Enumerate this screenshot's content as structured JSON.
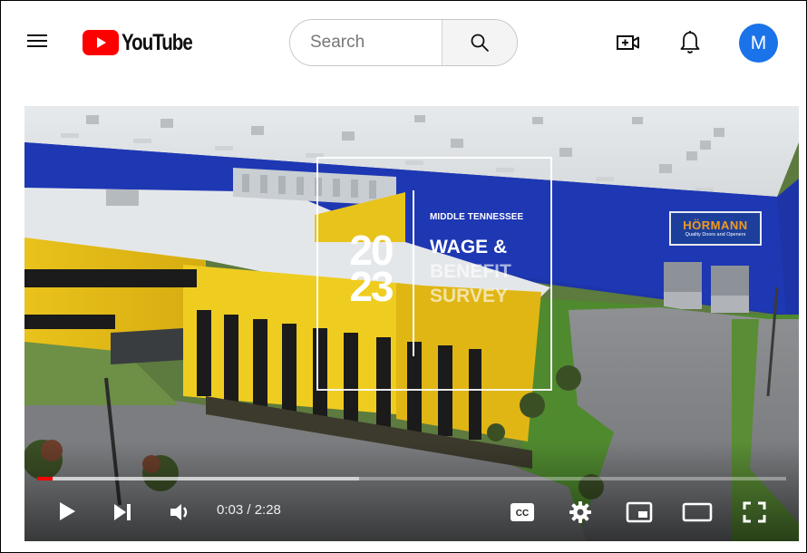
{
  "header": {
    "logo_text": "YouTube",
    "search_placeholder": "Search",
    "avatar_letter": "M",
    "brand_red": "#ff0000",
    "avatar_color": "#1a73e8"
  },
  "icons": {
    "menu": "hamburger-menu-icon",
    "search": "search-icon",
    "create": "create-video-icon",
    "notifications": "bell-icon"
  },
  "video": {
    "overlay": {
      "year_top": "20",
      "year_bottom": "23",
      "kicker": "MIDDLE TENNESSEE",
      "title_line1": "WAGE &",
      "title_line2": "BENEFIT",
      "title_line3": "SURVEY"
    },
    "sign": {
      "name": "HÖRMANN",
      "tagline": "Quality Doors and Openers"
    },
    "player": {
      "current_time": "0:03",
      "duration": "2:28",
      "time_display": "0:03 / 2:28",
      "played_fraction": 0.02,
      "loaded_fraction": 0.43,
      "progress_color": "#ff0000"
    },
    "controls": [
      "play-icon",
      "next-icon",
      "volume-icon",
      "captions-icon",
      "settings-icon",
      "miniplayer-icon",
      "theater-icon",
      "fullscreen-icon"
    ]
  }
}
